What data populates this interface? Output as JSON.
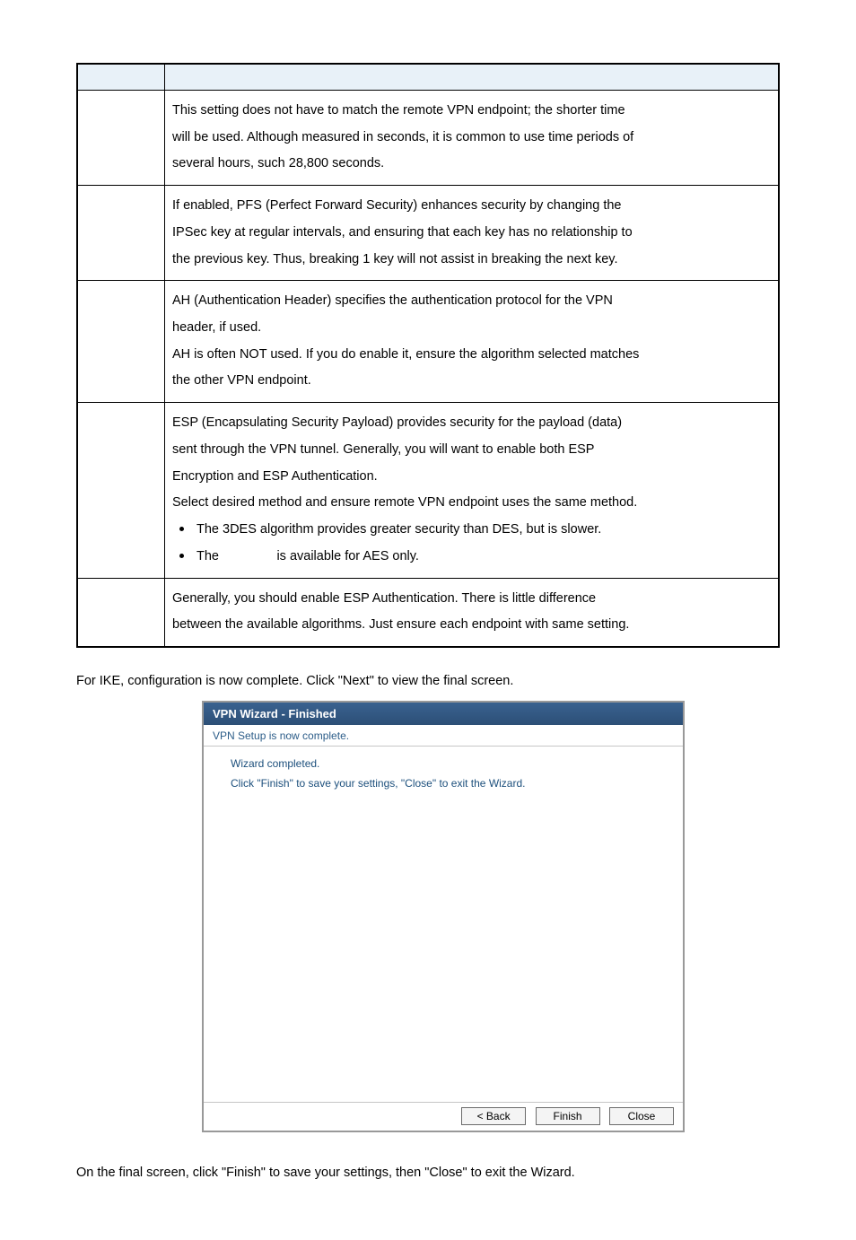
{
  "rows": [
    {
      "lines": [
        "This setting does not have to match the remote VPN endpoint; the shorter time",
        "will be used. Although measured in seconds, it is common to use time periods of",
        "several hours, such 28,800 seconds."
      ]
    },
    {
      "lines": [
        "If enabled, PFS (Perfect Forward Security) enhances security by changing the",
        "IPSec key at regular intervals, and ensuring that each key has no relationship to",
        "the previous key. Thus, breaking 1 key will not assist in breaking the next key."
      ]
    },
    {
      "lines": [
        "AH (Authentication Header) specifies the authentication protocol for the VPN",
        "header, if used.",
        "AH is often NOT used. If you do enable it, ensure the algorithm selected matches",
        "the other VPN endpoint."
      ]
    },
    {
      "lines": [
        "ESP (Encapsulating Security Payload) provides security for the payload (data)",
        "sent through the VPN tunnel. Generally, you will want to enable both ESP",
        "Encryption and ESP Authentication.",
        "Select desired method and ensure remote VPN endpoint uses the same method."
      ],
      "bullets": [
        "The 3DES algorithm provides greater security than DES, but is slower.",
        "The                is available for AES only."
      ]
    },
    {
      "lines": [
        "Generally, you should enable ESP Authentication. There is little difference",
        "between the available algorithms. Just ensure each endpoint with same setting."
      ],
      "last": true
    }
  ],
  "mid_text": "For IKE, configuration is now complete. Click \"Next\" to view the final screen.",
  "wizard": {
    "title": "VPN Wizard - Finished",
    "subtitle": "VPN Setup is now complete.",
    "heading": "Wizard completed.",
    "line2": "Click \"Finish\" to save your settings, \"Close\" to exit the Wizard.",
    "back": "< Back",
    "finish": "Finish",
    "close": "Close"
  },
  "bottom_text": "On the final screen, click \"Finish\" to save your settings, then \"Close\" to exit the Wizard."
}
